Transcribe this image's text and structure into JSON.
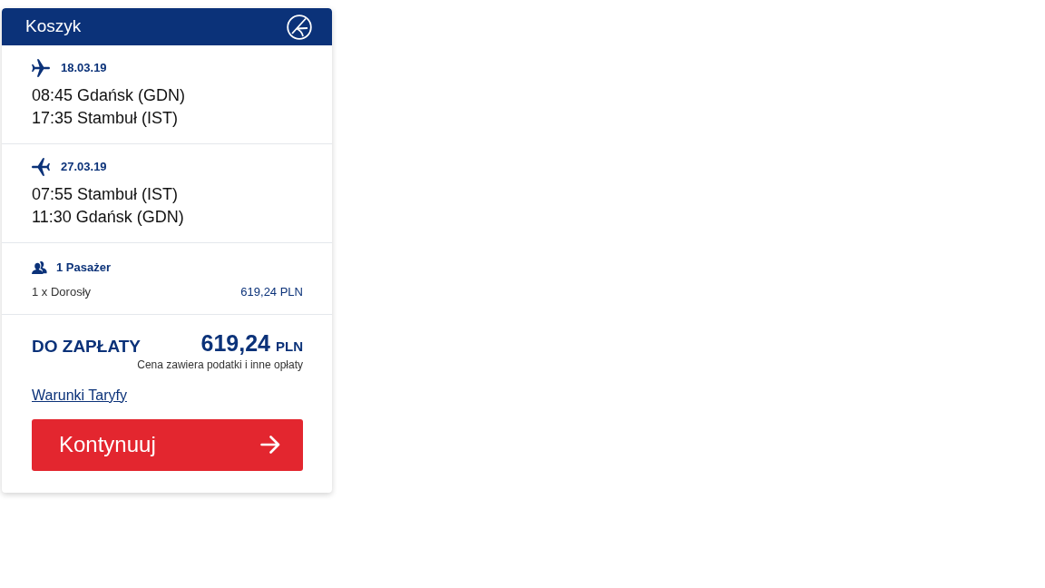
{
  "cart": {
    "title": "Koszyk"
  },
  "flights": [
    {
      "kind": "outbound",
      "date": "18.03.19",
      "departure": "08:45 Gdańsk (GDN)",
      "arrival": "17:35 Stambuł (IST)"
    },
    {
      "kind": "return",
      "date": "27.03.19",
      "departure": "07:55 Stambuł (IST)",
      "arrival": "11:30 Gdańsk (GDN)"
    }
  ],
  "passengers": {
    "heading": "1 Pasażer",
    "items": [
      {
        "label": "1 x Dorosły",
        "price": "619,24 PLN"
      }
    ]
  },
  "total": {
    "label": "DO ZAPŁATY",
    "amount": "619,24",
    "currency": "PLN",
    "note": "Cena zawiera podatki i inne opłaty"
  },
  "fare_link": "Warunki Taryfy",
  "continue_button": "Kontynuuj"
}
